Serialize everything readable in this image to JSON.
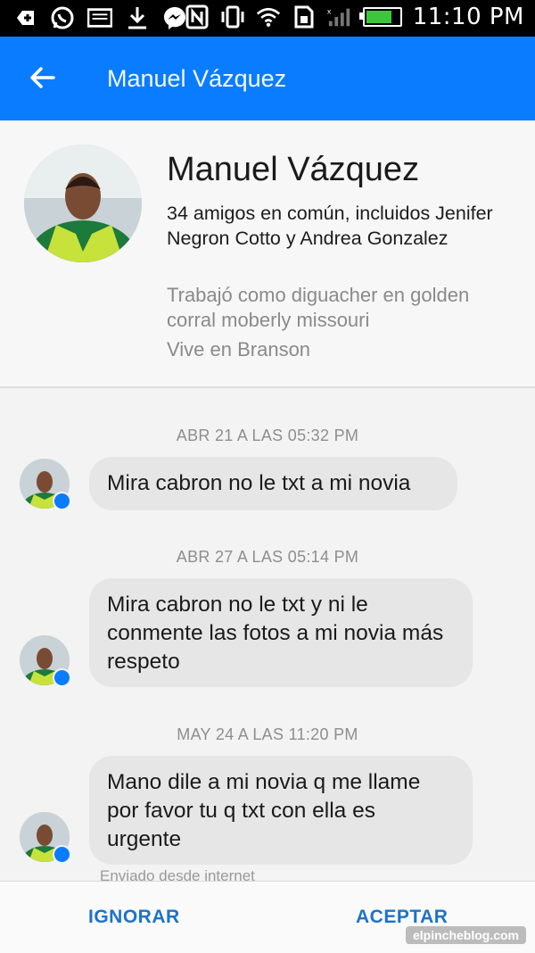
{
  "statusbar": {
    "time": "11:10 PM",
    "icons_left": [
      "add-icon",
      "whatsapp-icon",
      "message-icon",
      "download-icon",
      "messenger-icon"
    ],
    "icons_right": [
      "nfc-icon",
      "vibrate-icon",
      "wifi-icon",
      "sim-icon",
      "signal-icon",
      "battery-icon"
    ]
  },
  "appbar": {
    "title": "Manuel Vázquez"
  },
  "profile": {
    "name": "Manuel Vázquez",
    "mutual": "34 amigos en común, incluidos Jenifer Negron Cotto y Andrea Gonzalez",
    "work": "Trabajó como diguacher en golden corral moberly missouri",
    "lives": "Vive en Branson"
  },
  "messages": [
    {
      "timestamp": "ABR 21 A LAS 05:32 PM",
      "text": "Mira cabron no le txt a mi novia"
    },
    {
      "timestamp": "ABR 27 A LAS 05:14 PM",
      "text": "Mira cabron no le txt y ni le conmente las fotos a mi novia más respeto"
    },
    {
      "timestamp": "MAY 24 A LAS 11:20 PM",
      "text": "Mano dile a mi novia q me llame por favor tu q txt con ella es urgente"
    }
  ],
  "sent_from": "Enviado desde internet",
  "actions": {
    "ignore": "IGNORAR",
    "accept": "ACEPTAR"
  },
  "watermark": "elpincheblog.com",
  "colors": {
    "brand": "#0a7cff",
    "bubble": "#e6e6e6",
    "action": "#1d73c9"
  }
}
